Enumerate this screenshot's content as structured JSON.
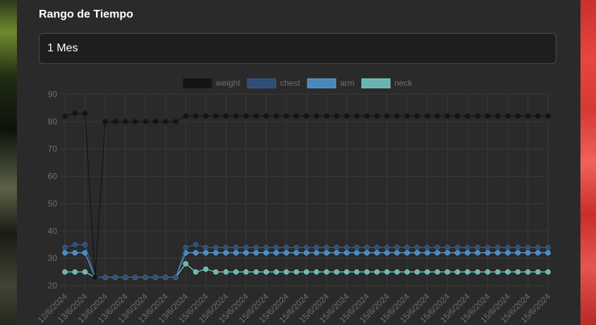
{
  "page": {
    "section_title": "Rango de Tiempo",
    "range_select": {
      "value": "1 Mes"
    }
  },
  "chart_data": {
    "type": "line",
    "title": "",
    "xlabel": "",
    "ylabel": "",
    "ylim": [
      20,
      90
    ],
    "yticks": [
      20,
      30,
      40,
      50,
      60,
      70,
      80,
      90
    ],
    "grid": true,
    "legend_position": "top",
    "categories": [
      "12/6/2024",
      "13/6/2024",
      "13/6/2024",
      "13/6/2024",
      "13/6/2024",
      "13/6/2024",
      "13/6/2024",
      "13/6/2024",
      "13/6/2024",
      "13/6/2024",
      "13/6/2024",
      "13/6/2024",
      "13/6/2024",
      "15/6/2024",
      "15/6/2024",
      "15/6/2024",
      "15/6/2024",
      "15/6/2024",
      "15/6/2024",
      "15/6/2024",
      "15/6/2024",
      "15/6/2024",
      "15/6/2024",
      "15/6/2024",
      "15/6/2024",
      "15/6/2024",
      "15/6/2024",
      "15/6/2024",
      "15/6/2024",
      "15/6/2024",
      "15/6/2024",
      "15/6/2024",
      "15/6/2024",
      "15/6/2024",
      "15/6/2024",
      "15/6/2024",
      "15/6/2024",
      "15/6/2024",
      "15/6/2024",
      "15/6/2024",
      "15/6/2024",
      "15/6/2024",
      "15/6/2024",
      "15/6/2024",
      "15/6/2024",
      "15/6/2024",
      "15/6/2024",
      "15/6/2024",
      "15/6/2024"
    ],
    "x_tick_labels": [
      "12/6/2024",
      "13/6/2024",
      "13/6/2024",
      "13/6/2024",
      "13/6/2024",
      "13/6/2024",
      "13/6/2024",
      "15/6/2024",
      "15/6/2024",
      "15/6/2024",
      "15/6/2024",
      "15/6/2024",
      "15/6/2024",
      "15/6/2024",
      "15/6/2024",
      "15/6/2024",
      "15/6/2024",
      "15/6/2024",
      "15/6/2024",
      "15/6/2024",
      "15/6/2024",
      "15/6/2024",
      "15/6/2024",
      "15/6/2024",
      "15/6/2024"
    ],
    "series": [
      {
        "name": "weight",
        "color": "#141414",
        "fill": "#141414",
        "values": [
          82,
          83,
          83,
          23,
          80,
          80,
          80,
          80,
          80,
          80,
          80,
          80,
          82,
          82,
          82,
          82,
          82,
          82,
          82,
          82,
          82,
          82,
          82,
          82,
          82,
          82,
          82,
          82,
          82,
          82,
          82,
          82,
          82,
          82,
          82,
          82,
          82,
          82,
          82,
          82,
          82,
          82,
          82,
          82,
          82,
          82,
          82,
          82,
          82
        ]
      },
      {
        "name": "chest",
        "color": "#3a5f94",
        "fill": "#2f4d75",
        "values": [
          34,
          35,
          35,
          23,
          23,
          23,
          23,
          23,
          23,
          23,
          23,
          23,
          34,
          35,
          34,
          34,
          34,
          34,
          34,
          34,
          34,
          34,
          34,
          34,
          34,
          34,
          34,
          34,
          34,
          34,
          34,
          34,
          34,
          34,
          34,
          34,
          34,
          34,
          34,
          34,
          34,
          34,
          34,
          34,
          34,
          34,
          34,
          34,
          34
        ]
      },
      {
        "name": "arm",
        "color": "#5aa6e0",
        "fill": "#4a86bb",
        "values": [
          32,
          32,
          32,
          23,
          23,
          23,
          23,
          23,
          23,
          23,
          23,
          23,
          32,
          32,
          32,
          32,
          32,
          32,
          32,
          32,
          32,
          32,
          32,
          32,
          32,
          32,
          32,
          32,
          32,
          32,
          32,
          32,
          32,
          32,
          32,
          32,
          32,
          32,
          32,
          32,
          32,
          32,
          32,
          32,
          32,
          32,
          32,
          32,
          32
        ]
      },
      {
        "name": "neck",
        "color": "#7fd6cf",
        "fill": "#6bb3ae",
        "values": [
          25,
          25,
          25,
          23,
          23,
          23,
          23,
          23,
          23,
          23,
          23,
          23,
          28,
          25,
          26,
          25,
          25,
          25,
          25,
          25,
          25,
          25,
          25,
          25,
          25,
          25,
          25,
          25,
          25,
          25,
          25,
          25,
          25,
          25,
          25,
          25,
          25,
          25,
          25,
          25,
          25,
          25,
          25,
          25,
          25,
          25,
          25,
          25,
          25
        ]
      }
    ]
  }
}
